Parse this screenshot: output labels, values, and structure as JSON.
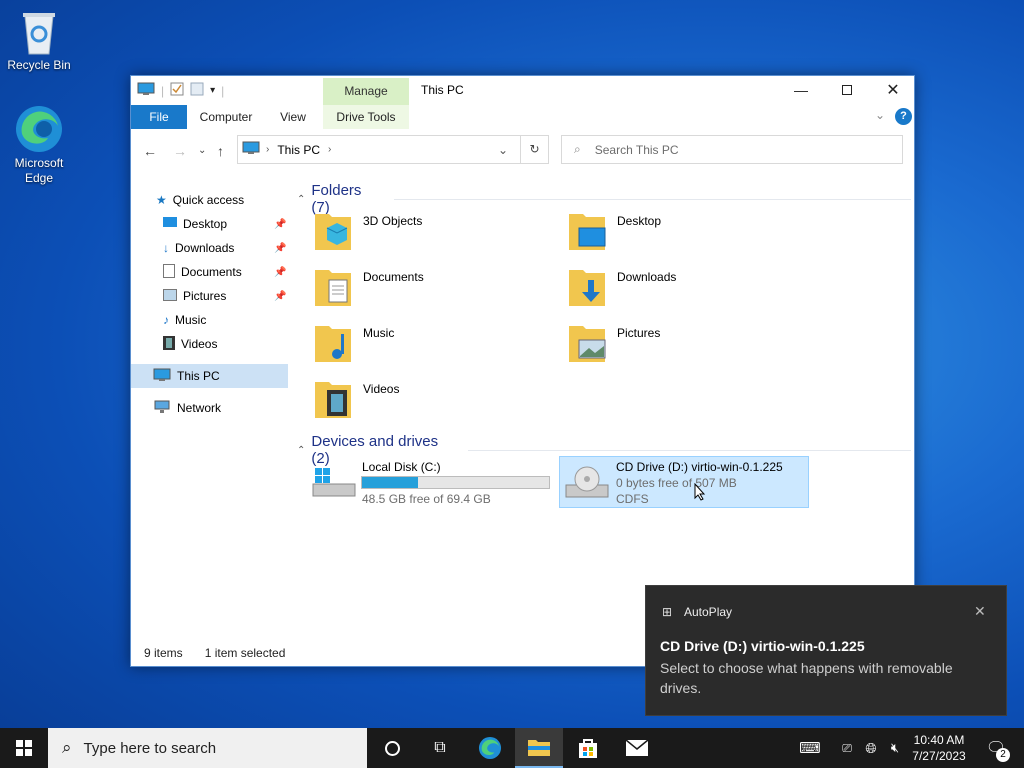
{
  "desktop": {
    "recycle_bin": "Recycle Bin",
    "edge_line1": "Microsoft",
    "edge_line2": "Edge"
  },
  "window": {
    "title": "This PC",
    "manage_tab": "Manage",
    "tabs": [
      "File",
      "Computer",
      "View",
      "Drive Tools"
    ],
    "address": "This PC",
    "search_placeholder": "Search This PC"
  },
  "nav": {
    "quick_access": "Quick access",
    "items": [
      "Desktop",
      "Downloads",
      "Documents",
      "Pictures",
      "Music",
      "Videos"
    ],
    "this_pc": "This PC",
    "network": "Network"
  },
  "content": {
    "folders_header": "Folders (7)",
    "folders": [
      "3D Objects",
      "Desktop",
      "Documents",
      "Downloads",
      "Music",
      "Pictures",
      "Videos"
    ],
    "devices_header": "Devices and drives (2)",
    "drive_c": {
      "name": "Local Disk (C:)",
      "free": "48.5 GB free of 69.4 GB",
      "used_fraction": 0.3
    },
    "drive_d": {
      "name": "CD Drive (D:) virtio-win-0.1.225",
      "free": "0 bytes free of 507 MB",
      "fs": "CDFS"
    }
  },
  "status": {
    "items": "9 items",
    "selected": "1 item selected"
  },
  "toast": {
    "app": "AutoPlay",
    "title": "CD Drive (D:) virtio-win-0.1.225",
    "body": "Select to choose what happens with removable drives."
  },
  "taskbar": {
    "search_placeholder": "Type here to search",
    "time": "10:40 AM",
    "date": "7/27/2023",
    "notif_count": "2"
  },
  "colors": {
    "accent": "#1979ca",
    "selection": "#cce8ff",
    "taskbar": "#1a1a1a",
    "manage": "#d9f0c6"
  }
}
